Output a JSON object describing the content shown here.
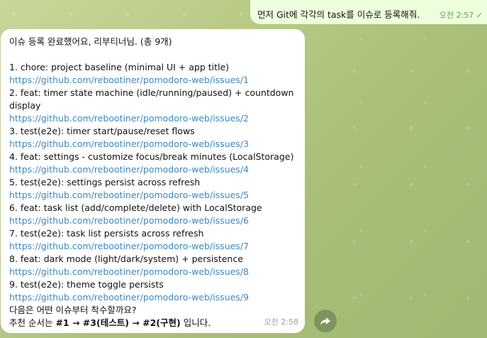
{
  "outgoing": {
    "text": "먼저 Git에 각각의 task를 이슈로 등록해줘.",
    "time": "오전 2:57",
    "check": "✓"
  },
  "incoming": {
    "intro": "이슈 등록 완료했어요, 리부티너님. (총 9개)",
    "issues": [
      {
        "title": "1. chore: project baseline (minimal UI + app title)",
        "url": "https://github.com/rebootiner/pomodoro-web/issues/1"
      },
      {
        "title": "2. feat: timer state machine (idle/running/paused) + countdown display",
        "url": "https://github.com/rebootiner/pomodoro-web/issues/2"
      },
      {
        "title": "3. test(e2e): timer start/pause/reset flows",
        "url": "https://github.com/rebootiner/pomodoro-web/issues/3"
      },
      {
        "title": "4. feat: settings - customize focus/break minutes (LocalStorage)",
        "url": "https://github.com/rebootiner/pomodoro-web/issues/4"
      },
      {
        "title": "5. test(e2e): settings persist across refresh",
        "url": "https://github.com/rebootiner/pomodoro-web/issues/5"
      },
      {
        "title": "6. feat: task list (add/complete/delete) with LocalStorage",
        "url": "https://github.com/rebootiner/pomodoro-web/issues/6"
      },
      {
        "title": "7. test(e2e): task list persists across refresh",
        "url": "https://github.com/rebootiner/pomodoro-web/issues/7"
      },
      {
        "title": "8. feat: dark mode (light/dark/system) + persistence",
        "url": "https://github.com/rebootiner/pomodoro-web/issues/8"
      },
      {
        "title": "9. test(e2e): theme toggle persists",
        "url": "https://github.com/rebootiner/pomodoro-web/issues/9"
      }
    ],
    "question": "다음은 어떤 이슈부터 착수할까요?",
    "rec_prefix": "추천 순서는 ",
    "rec_1": "#1 → #3(",
    "rec_2": "테스트",
    "rec_3": ") → #2(",
    "rec_4": "구현",
    "rec_5": ")",
    "rec_suffix": " 입니다.",
    "time": "오전 2:58"
  },
  "icons": {
    "share": "share-icon"
  }
}
